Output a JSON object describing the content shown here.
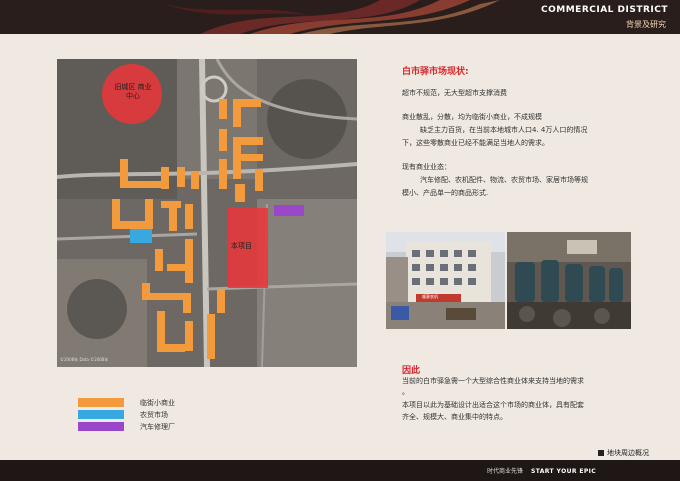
{
  "header": {
    "title_en": "COMMERCIAL DISTRICT",
    "title_cn": "背景及研究"
  },
  "footer": {
    "slogan_cn": "时代商业先锋",
    "slogan_en": "START YOUR EPIC",
    "section": "地块周边概况"
  },
  "map": {
    "old_center_label": "旧城区 商业中心",
    "project_label": "本项目",
    "credit": "©2008年  Data ©2008年",
    "colors": {
      "street_shops": "#f39a3c",
      "farmers_market": "#38a9e0",
      "auto_repair": "#9b47c9",
      "project": "#e8373a",
      "old_center": "#e8373a"
    }
  },
  "legend": [
    {
      "label": "临街小商业",
      "color": "#f39a3c"
    },
    {
      "label": "农贸市场",
      "color": "#38a9e0"
    },
    {
      "label": "汽车修理厂",
      "color": "#9b47c9"
    }
  ],
  "analysis": {
    "heading": "白市驿市场现状:",
    "p1": "超市不规范，无大型超市支撑消费",
    "p2_line1": "商业散乱，分散，均为临街小商业，不成规模",
    "p2_line2": "缺乏主力百货，在当前本地城市人口4. 4万人口的情况",
    "p2_line3": "下，这些零散商业已经不能满足当地人的需求。",
    "p3_title": "现有商业业态：",
    "p3_line1": "汽车修配、农机配件、物流、农贸市场、家居市场等规",
    "p3_line2": "模小、产品单一的商品形式."
  },
  "conclusion": {
    "heading": "因此",
    "line1": "当前的白市驿急需一个大型综合性商业体来支持当地的需求",
    "line1_end": "。",
    "line2": "本项目以此为基础设计出适合这个市场的商业体，具有配套",
    "line3": "齐全、规模大、商业集中的特点。"
  },
  "photos": {
    "left_sign": "顺意农机",
    "right_sign": ""
  }
}
